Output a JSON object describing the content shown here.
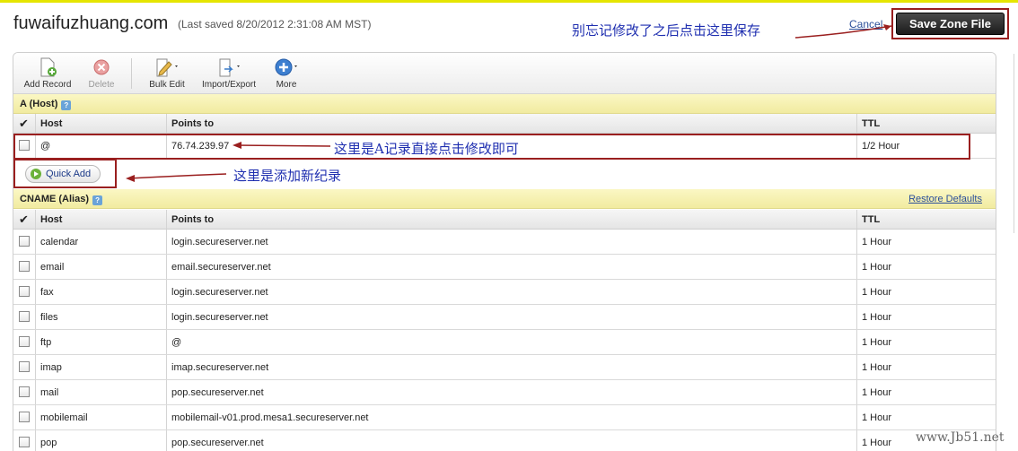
{
  "header": {
    "domain": "fuwaifuzhuang.com",
    "last_saved": "(Last saved 8/20/2012 2:31:08 AM MST)",
    "cancel_label": "Cancel",
    "save_label": "Save Zone File"
  },
  "annotations": {
    "save_note": "别忘记修改了之后点击这里保存",
    "a_record_note": "这里是A记录直接点击修改即可",
    "quick_add_note": "这里是添加新纪录"
  },
  "toolbar": {
    "add_record": "Add Record",
    "delete": "Delete",
    "bulk_edit": "Bulk Edit",
    "import_export": "Import/Export",
    "more": "More"
  },
  "columns": {
    "host": "Host",
    "points_to": "Points to",
    "ttl": "TTL"
  },
  "a_section": {
    "title": "A (Host)",
    "rows": [
      {
        "host": "@",
        "points_to": "76.74.239.97",
        "ttl": "1/2 Hour"
      }
    ],
    "quick_add": "Quick Add"
  },
  "cname_section": {
    "title": "CNAME (Alias)",
    "restore_defaults": "Restore Defaults",
    "rows": [
      {
        "host": "calendar",
        "points_to": "login.secureserver.net",
        "ttl": "1 Hour"
      },
      {
        "host": "email",
        "points_to": "email.secureserver.net",
        "ttl": "1 Hour"
      },
      {
        "host": "fax",
        "points_to": "login.secureserver.net",
        "ttl": "1 Hour"
      },
      {
        "host": "files",
        "points_to": "login.secureserver.net",
        "ttl": "1 Hour"
      },
      {
        "host": "ftp",
        "points_to": "@",
        "ttl": "1 Hour"
      },
      {
        "host": "imap",
        "points_to": "imap.secureserver.net",
        "ttl": "1 Hour"
      },
      {
        "host": "mail",
        "points_to": "pop.secureserver.net",
        "ttl": "1 Hour"
      },
      {
        "host": "mobilemail",
        "points_to": "mobilemail-v01.prod.mesa1.secureserver.net",
        "ttl": "1 Hour"
      },
      {
        "host": "pop",
        "points_to": "pop.secureserver.net",
        "ttl": "1 Hour"
      }
    ]
  },
  "watermark": "www.Jb51.net",
  "colors": {
    "section_bg": "#f1eba0",
    "annotation": "#1f2fb0",
    "highlight_box": "#9a1f1f",
    "link": "#2b4f9a"
  }
}
